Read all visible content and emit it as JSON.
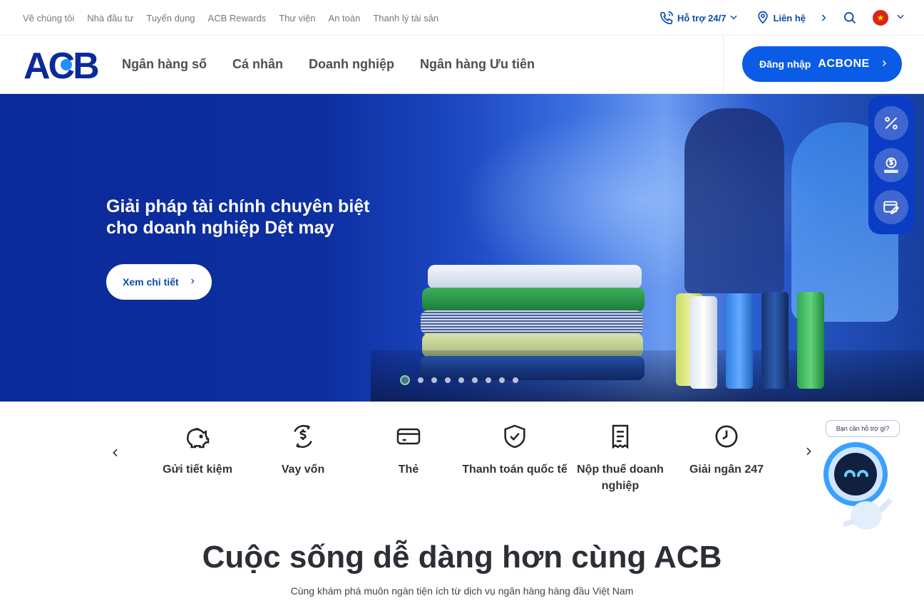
{
  "topbar": {
    "links": [
      "Về chúng tôi",
      "Nhà đầu tư",
      "Tuyển dụng",
      "ACB Rewards",
      "Thư viện",
      "An toàn",
      "Thanh lý tài sản"
    ],
    "support_label": "Hỗ trợ 24/7",
    "contact_label": "Liên hệ"
  },
  "nav": {
    "logo_text": "ACB",
    "items": [
      "Ngân hàng số",
      "Cá nhân",
      "Doanh nghiệp",
      "Ngân hàng Ưu tiên"
    ],
    "login_label": "Đăng nhập",
    "login_brand": "ACBONE"
  },
  "hero": {
    "title_line1": "Giải pháp tài chính chuyên biệt",
    "title_line2": "cho doanh nghiệp Dệt may",
    "cta_label": "Xem chi tiết",
    "slide_count": 9,
    "active_slide": 1
  },
  "sidetools": [
    "percent-icon",
    "money-hand-icon",
    "card-edit-icon"
  ],
  "services": [
    {
      "label": "Gửi tiết kiệm",
      "icon": "piggy-bank-icon"
    },
    {
      "label": "Vay vốn",
      "icon": "loan-icon"
    },
    {
      "label": "Thẻ",
      "icon": "card-icon"
    },
    {
      "label": "Thanh toán quốc tế",
      "icon": "shield-check-icon"
    },
    {
      "label": "Nộp thuế doanh nghiệp",
      "icon": "receipt-icon"
    },
    {
      "label": "Giải ngân 247",
      "icon": "clock-icon"
    }
  ],
  "chatbot": {
    "bubble_text": "Bạn cần hỗ trợ gì?"
  },
  "section": {
    "headline": "Cuộc sống dễ dàng hơn cùng ACB",
    "subline": "Cùng khám phá muôn ngàn tiện ích từ dịch vụ ngân hàng hàng đầu Việt Nam"
  },
  "colors": {
    "brand_blue": "#0a5ce6",
    "dark_blue": "#0b2a9a",
    "nav_text": "#4a4f57"
  }
}
